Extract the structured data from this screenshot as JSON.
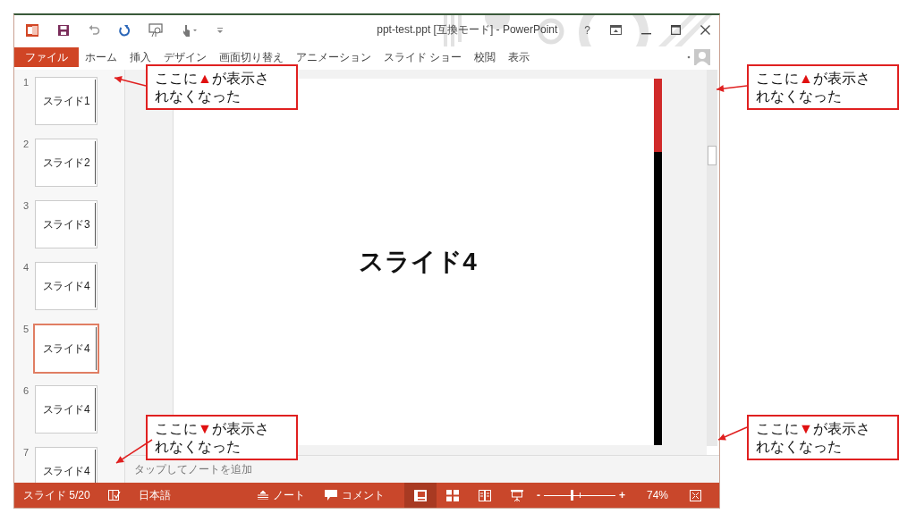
{
  "window": {
    "title": "ppt-test.ppt [互換モード] - PowerPoint",
    "help": "?"
  },
  "ribbon_tabs": [
    {
      "label": "ファイル",
      "selected": true
    },
    {
      "label": "ホーム",
      "selected": false
    },
    {
      "label": "挿入",
      "selected": false
    },
    {
      "label": "デザイン",
      "selected": false
    },
    {
      "label": "画面切り替え",
      "selected": false
    },
    {
      "label": "アニメーション",
      "selected": false
    },
    {
      "label": "スライド ショー",
      "selected": false
    },
    {
      "label": "校閲",
      "selected": false
    },
    {
      "label": "表示",
      "selected": false
    }
  ],
  "thumbnails": [
    {
      "number": "1",
      "text": "スライド1",
      "selected": false
    },
    {
      "number": "2",
      "text": "スライド2",
      "selected": false
    },
    {
      "number": "3",
      "text": "スライド3",
      "selected": false
    },
    {
      "number": "4",
      "text": "スライド4",
      "selected": false
    },
    {
      "number": "5",
      "text": "スライド4",
      "selected": true
    },
    {
      "number": "6",
      "text": "スライド4",
      "selected": false
    },
    {
      "number": "7",
      "text": "スライド4",
      "selected": false
    }
  ],
  "slide": {
    "title": "スライド4"
  },
  "notes": {
    "placeholder": "タップしてノートを追加"
  },
  "status_bar": {
    "slide": "スライド 5/20",
    "language": "日本語",
    "notes": "ノート",
    "comments": "コメント",
    "views": [
      {
        "kind": "normal",
        "selected": true
      },
      {
        "kind": "sorter",
        "selected": false
      },
      {
        "kind": "reading",
        "selected": false
      },
      {
        "kind": "slideshow",
        "selected": false
      }
    ],
    "zoom_out": "-",
    "zoom_in": "+",
    "zoom": {
      "level": 0.4
    },
    "zoom_reading": "74%"
  },
  "callouts": [
    {
      "lead": "ここに",
      "mark": "▲",
      "tail": "が表示されなくなった"
    },
    {
      "lead": "ここに",
      "mark": "▲",
      "tail": "が表示されなくなった"
    },
    {
      "lead": "ここに",
      "mark": "▼",
      "tail": "が表示されなくなった"
    },
    {
      "lead": "ここに",
      "mark": "▼",
      "tail": "が表示されなくなった"
    }
  ]
}
